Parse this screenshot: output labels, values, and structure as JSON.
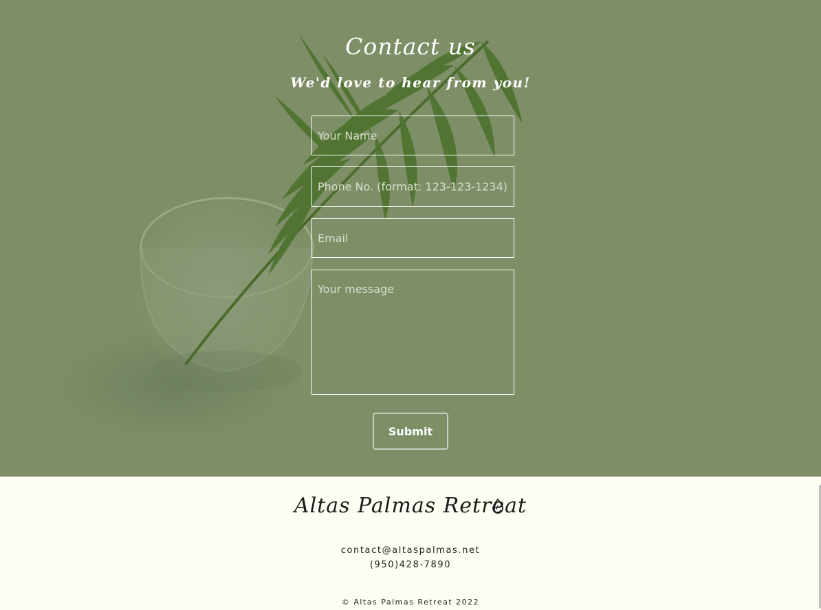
{
  "contact_section": {
    "title": "Contact us",
    "subtitle": "We'd love to hear from you!",
    "form": {
      "name_placeholder": "Your Name",
      "phone_placeholder": "Phone No. (format: 123-123-1234)",
      "email_placeholder": "Email",
      "message_placeholder": "Your message",
      "submit_label": "Submit"
    }
  },
  "footer": {
    "brand": "Altas Palmas Retreat",
    "brand_icon": "water-drop-icon",
    "email": "contact@altaspalmas.net",
    "phone": "(950)428-7890",
    "copyright": "© Altas Palmas Retreat 2022"
  },
  "colors": {
    "hero_overlay": "#7e8f68",
    "footer_bg": "#fefdf3",
    "text_light": "#ffffff",
    "text_dark": "#1a1a1a"
  }
}
